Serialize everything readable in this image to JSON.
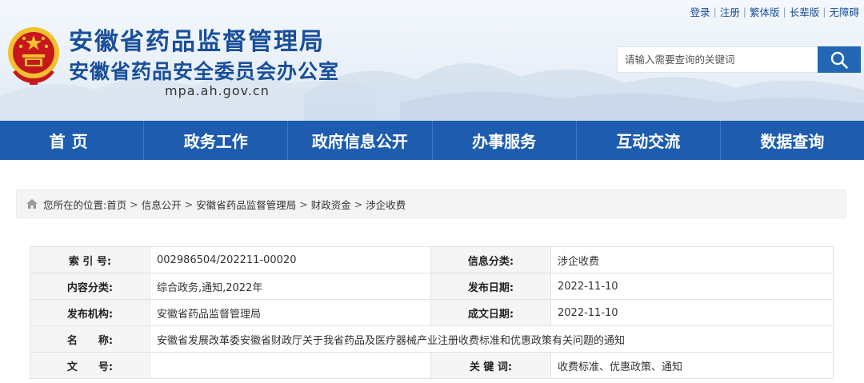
{
  "header": {
    "title_main": "安徽省药品监督管理局",
    "title_sub": "安徽省药品安全委员会办公室",
    "domain": "mpa.ah.gov.cn",
    "links": [
      "登录",
      "注册",
      "繁体版",
      "长辈版",
      "无障碍"
    ]
  },
  "search": {
    "placeholder": "请输入需要查询的关键词",
    "icon": "search-icon"
  },
  "nav": [
    "首页",
    "政务工作",
    "政府信息公开",
    "办事服务",
    "互动交流",
    "数据查询"
  ],
  "breadcrumb": {
    "prefix": "您所在的位置:",
    "items": [
      "首页",
      "信息公开",
      "安徽省药品监督管理局",
      "财政资金",
      "涉企收费"
    ],
    "icon": "home-icon"
  },
  "info": {
    "index_label": "索 引 号:",
    "index_value": "002986504/202211-00020",
    "category_label": "信息分类:",
    "category_value": "涉企收费",
    "content_label": "内容分类:",
    "content_value": "综合政务,通知,2022年",
    "pubdate_label": "发布日期:",
    "pubdate_value": "2022-11-10",
    "org_label": "发布机构:",
    "org_value": "安徽省药品监督管理局",
    "docdate_label": "成文日期:",
    "docdate_value": "2022-11-10",
    "name_label": "名　　称:",
    "name_value": "安徽省发展改革委安徽省财政厅关于我省药品及医疗器械产业注册收费标准和优惠政策有关问题的通知",
    "docno_label": "文　　号:",
    "docno_value": "",
    "keywords_label": "关 键 词:",
    "keywords_value": "收费标准、优惠政策、通知"
  },
  "colors": {
    "brand_blue": "#1a4f9a",
    "nav_blue": "#1d5cae",
    "search_button": "#2266b4",
    "emblem_red": "#c8161d",
    "emblem_gold": "#f2c12e"
  }
}
